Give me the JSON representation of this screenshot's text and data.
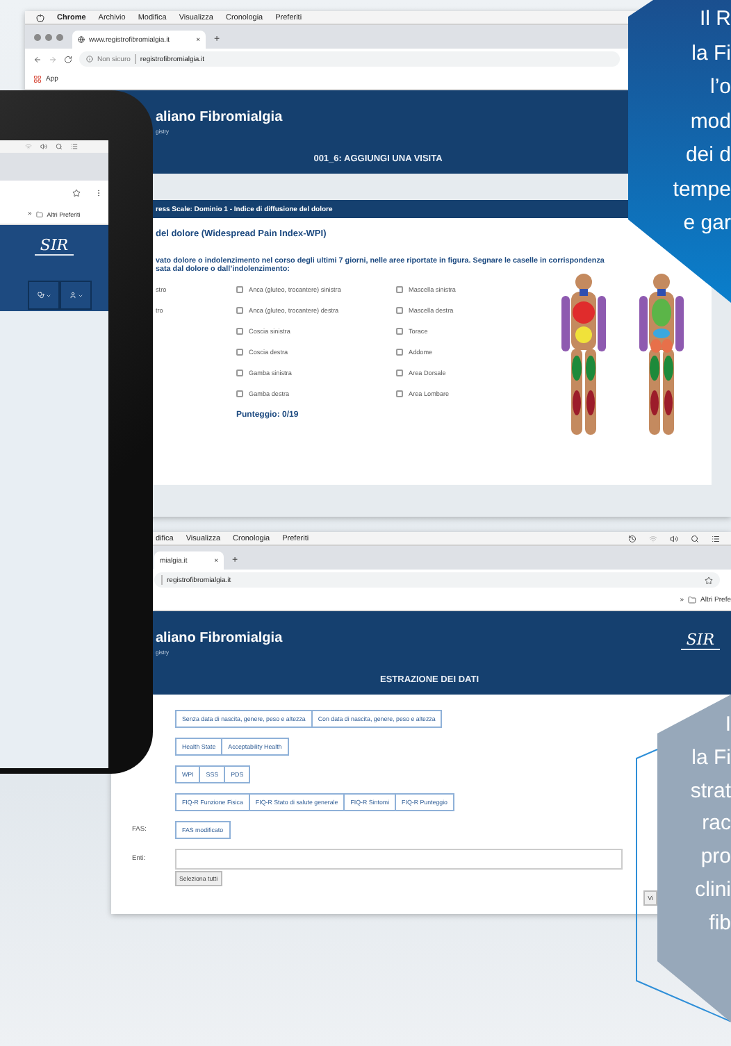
{
  "browser_top": {
    "app_name": "Chrome",
    "menu": [
      "Archivio",
      "Modifica",
      "Visualizza",
      "Cronologia",
      "Preferiti"
    ],
    "tab_title": "www.registrofibromialgia.it",
    "tab_close": "×",
    "new_tab": "+",
    "security": "Non sicuro",
    "url": "registrofibromialgia.it",
    "bookmark": "App",
    "site_title": "aliano Fibromialgia",
    "site_subtitle": "gistry",
    "page_title": "001_6: AGGIUNGI UNA VISITA",
    "card": {
      "header": "ress Scale: Dominio 1 - Indice di diffusione del dolore",
      "section_title": "del dolore (Widespread Pain Index-WPI)",
      "question": [
        "vato dolore o indolenzimento nel corso degli ultimi 7 giorni, nelle aree riportate in figura. Segnare le caselle in corrispondenza",
        "sata dal dolore o dall’indolenzimento:"
      ],
      "cut_labels": [
        "stro",
        "tro"
      ],
      "columns": [
        [
          {
            "label": "Anca (gluteo, trocantere) sinistra",
            "checked": false
          },
          {
            "label": "Anca (gluteo, trocantere) destra",
            "checked": false
          },
          {
            "label": "Coscia sinistra",
            "checked": false
          },
          {
            "label": "Coscia destra",
            "checked": false
          },
          {
            "label": "Gamba sinistra",
            "checked": false
          },
          {
            "label": "Gamba destra",
            "checked": false
          }
        ],
        [
          {
            "label": "Mascella sinistra",
            "checked": false
          },
          {
            "label": "Mascella destra",
            "checked": false
          },
          {
            "label": "Torace",
            "checked": false
          },
          {
            "label": "Addome",
            "checked": false
          },
          {
            "label": "Area Dorsale",
            "checked": false
          },
          {
            "label": "Area Lombare",
            "checked": false
          }
        ]
      ],
      "score": "Punteggio: 0/19"
    }
  },
  "tablet": {
    "bookmarks_more": "»",
    "bookmark_folder": "Altri Preferiti",
    "logo_text": "SIR"
  },
  "browser_bottom": {
    "menu": [
      "difica",
      "Visualizza",
      "Cronologia",
      "Preferiti"
    ],
    "tab_title": "mialgia.it",
    "tab_close": "×",
    "new_tab": "+",
    "url": "registrofibromialgia.it",
    "bookmarks_more": "»",
    "bookmark_folder": "Altri Prefe",
    "site_title": "aliano Fibromialgia",
    "site_subtitle": "gistry",
    "logo_text": "SIR",
    "page_title": "ESTRAZIONE DEI DATI",
    "groups": [
      {
        "buttons": [
          "Senza data di nascita, genere, peso e altezza",
          "Con data di nascita, genere, peso e altezza"
        ]
      },
      {
        "buttons": [
          "Health State",
          "Acceptability Health"
        ]
      },
      {
        "buttons": [
          "WPI",
          "SSS",
          "PDS"
        ]
      },
      {
        "buttons": [
          "FIQ-R Funzione Fisica",
          "FIQ-R Stato di salute generale",
          "FIQ-R Sintomi",
          "FIQ-R Punteggio"
        ]
      },
      {
        "label": "FAS:",
        "buttons": [
          "FAS modificato"
        ]
      }
    ],
    "entities_label": "Enti:",
    "select_all": "Seleziona tutti",
    "view_button": "Vi"
  },
  "callouts": [
    {
      "kind": "blue",
      "lines": [
        "Il R",
        "la Fi",
        "l’o",
        "mod",
        "dei d",
        "tempe",
        "e gar"
      ]
    },
    {
      "kind": "grey",
      "lines": [
        "I",
        "la Fi",
        "strat",
        "rac",
        "pro",
        "clini",
        "fib"
      ]
    }
  ]
}
